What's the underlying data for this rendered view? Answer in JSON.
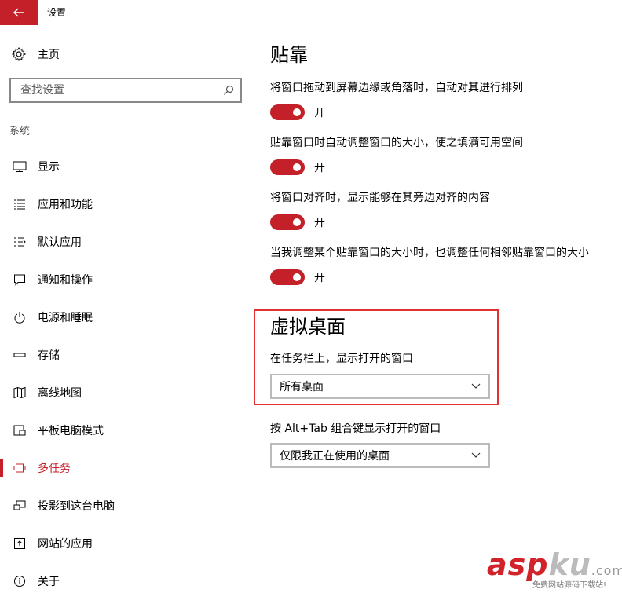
{
  "window": {
    "title": "设置"
  },
  "sidebar": {
    "home_label": "主页",
    "search_placeholder": "查找设置",
    "section_label": "系统",
    "items": [
      {
        "label": "显示",
        "icon": "monitor-icon"
      },
      {
        "label": "应用和功能",
        "icon": "list-icon"
      },
      {
        "label": "默认应用",
        "icon": "default-apps-icon"
      },
      {
        "label": "通知和操作",
        "icon": "message-icon"
      },
      {
        "label": "电源和睡眠",
        "icon": "power-icon"
      },
      {
        "label": "存储",
        "icon": "storage-icon"
      },
      {
        "label": "离线地图",
        "icon": "map-icon"
      },
      {
        "label": "平板电脑模式",
        "icon": "tablet-icon"
      },
      {
        "label": "多任务",
        "icon": "multitask-icon",
        "active": true
      },
      {
        "label": "投影到这台电脑",
        "icon": "project-icon"
      },
      {
        "label": "网站的应用",
        "icon": "web-apps-icon"
      },
      {
        "label": "关于",
        "icon": "info-icon"
      }
    ]
  },
  "snap": {
    "title": "贴靠",
    "settings": [
      {
        "label": "将窗口拖动到屏幕边缘或角落时，自动对其进行排列",
        "state": "开"
      },
      {
        "label": "贴靠窗口时自动调整窗口的大小，使之填满可用空间",
        "state": "开"
      },
      {
        "label": "将窗口对齐时，显示能够在其旁边对齐的内容",
        "state": "开"
      },
      {
        "label": "当我调整某个贴靠窗口的大小时，也调整任何相邻贴靠窗口的大小",
        "state": "开"
      }
    ]
  },
  "virtual_desktops": {
    "title": "虚拟桌面",
    "taskbar_label": "在任务栏上，显示打开的窗口",
    "taskbar_value": "所有桌面",
    "alttab_label": "按 Alt+Tab 组合键显示打开的窗口",
    "alttab_value": "仅限我正在使用的桌面"
  },
  "watermark": {
    "brand_red": "asp",
    "brand_gray": "ku",
    "brand_suffix": ".com",
    "subtitle": "免费网站源码下载站!"
  },
  "colors": {
    "accent": "#c4202a",
    "highlight": "#e03030"
  }
}
